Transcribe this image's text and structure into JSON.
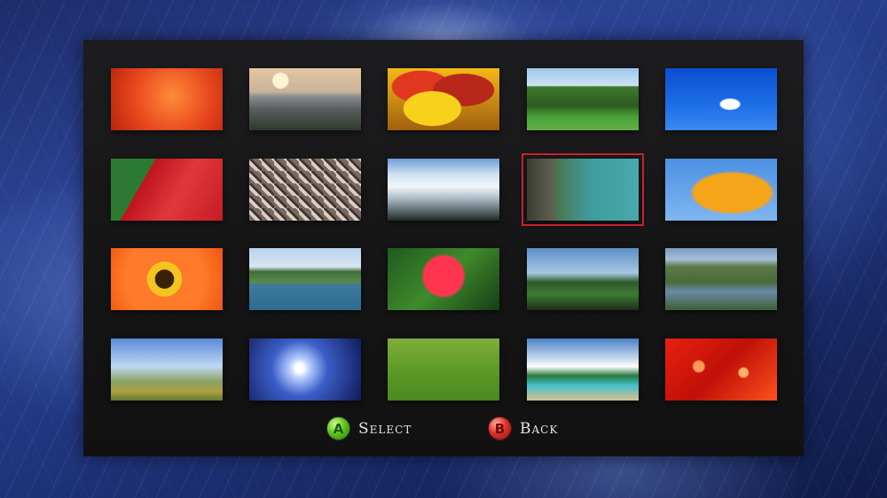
{
  "gallery": {
    "selected_index": 8,
    "thumbnails": [
      {
        "name": "photo-red-leaf"
      },
      {
        "name": "photo-sunset-sea"
      },
      {
        "name": "photo-yellow-pansy"
      },
      {
        "name": "photo-park-trees"
      },
      {
        "name": "photo-blue-sky-cloud"
      },
      {
        "name": "photo-red-green-leaves"
      },
      {
        "name": "photo-mosaic-floor"
      },
      {
        "name": "photo-snowy-mountains"
      },
      {
        "name": "photo-lagoon-palm"
      },
      {
        "name": "photo-autumn-tree"
      },
      {
        "name": "photo-orange-gerbera"
      },
      {
        "name": "photo-coast-cliffs"
      },
      {
        "name": "photo-red-hibiscus"
      },
      {
        "name": "photo-hill-landscape"
      },
      {
        "name": "photo-mountain-lake-path"
      },
      {
        "name": "photo-wind-turbines"
      },
      {
        "name": "photo-blue-light-burst"
      },
      {
        "name": "photo-sheep-field"
      },
      {
        "name": "photo-beach-resort"
      },
      {
        "name": "photo-christmas-tree-bokeh"
      }
    ]
  },
  "controls": {
    "select": {
      "button": "A",
      "label": "Select"
    },
    "back": {
      "button": "B",
      "label": "Back"
    }
  },
  "colors": {
    "selection_outline": "#c4232a",
    "panel_background": "#161617",
    "accent_green": "#5fc423",
    "accent_red": "#e0302a"
  }
}
